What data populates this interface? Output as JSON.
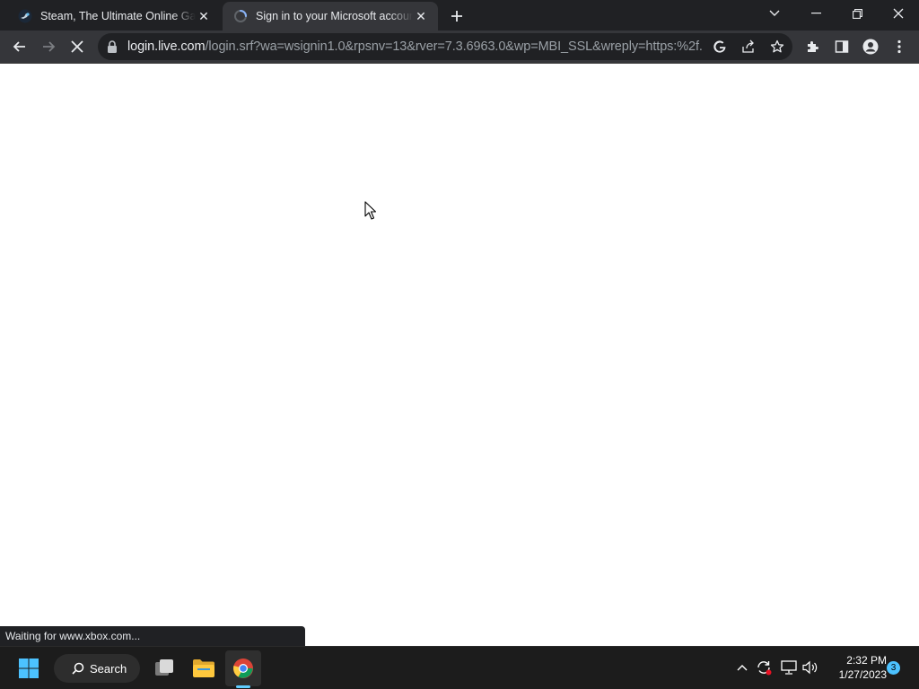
{
  "browser": {
    "tabs": [
      {
        "title": "Steam, The Ultimate Online Game Platform",
        "favicon": "steam-icon",
        "active": false
      },
      {
        "title": "Sign in to your Microsoft account",
        "favicon": "loading-spinner-icon",
        "active": true
      }
    ],
    "url": {
      "host": "login.live.com",
      "path": "/login.srf?wa=wsignin1.0&rpsnv=13&rver=7.3.6963.0&wp=MBI_SSL&wreply=https:%2f..."
    },
    "status_text": "Waiting for www.xbox.com..."
  },
  "taskbar": {
    "search_label": "Search",
    "time": "2:32 PM",
    "date": "1/27/2023",
    "notification_count": "3"
  },
  "colors": {
    "titlebar": "#202124",
    "toolbar": "#35363a",
    "taskbar": "#1c1c1c",
    "accent": "#60cdff"
  }
}
